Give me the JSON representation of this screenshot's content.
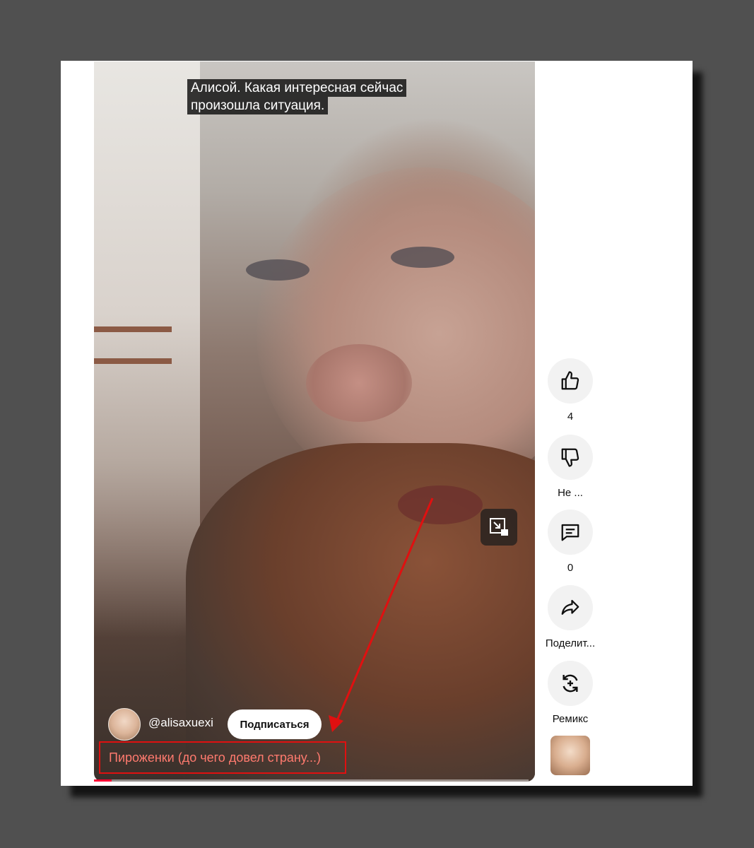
{
  "player": {
    "caption_lines": [
      "Алисой. Какая интересная сейчас",
      "произошла ситуация."
    ],
    "channel_handle": "@alisaxuexi",
    "subscribe_label": "Подписаться",
    "video_title": "Пироженки (до чего довел страну...)",
    "progress_fraction": 0.04
  },
  "actions": {
    "like": {
      "icon": "thumb-up-icon",
      "label": "4"
    },
    "dislike": {
      "icon": "thumb-down-icon",
      "label": "Не ..."
    },
    "comments": {
      "icon": "comment-icon",
      "label": "0"
    },
    "share": {
      "icon": "share-icon",
      "label": "Поделит..."
    },
    "remix": {
      "icon": "remix-icon",
      "label": "Ремикс"
    }
  },
  "colors": {
    "annotation_red": "#e01010",
    "progress_red": "#ff0033",
    "backdrop": "#505050"
  }
}
